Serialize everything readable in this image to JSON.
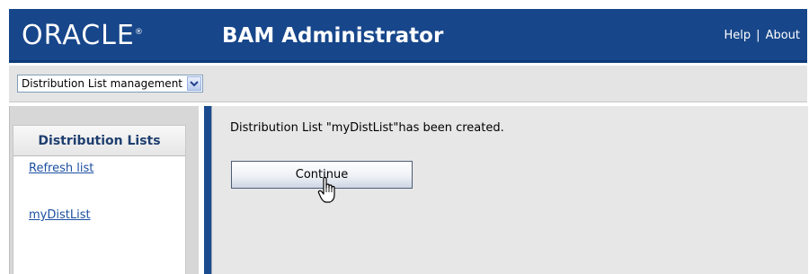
{
  "header": {
    "logo_text": "ORACLE",
    "logo_mark": "®",
    "title": "BAM Administrator",
    "links": [
      {
        "label": "Help"
      },
      {
        "label": "About"
      }
    ],
    "separator": "|",
    "color": "#17468a"
  },
  "toolbar": {
    "selected_view": "Distribution List management"
  },
  "sidebar": {
    "title": "Distribution Lists",
    "refresh_label": "Refresh list",
    "items": [
      {
        "label": "myDistList"
      }
    ]
  },
  "main": {
    "message": "Distribution List \"myDistList\"has been created.",
    "continue_label": "Continue"
  },
  "icons": {
    "select_arrow": "chevron-down-icon",
    "cursor": "hand-pointer-icon"
  }
}
